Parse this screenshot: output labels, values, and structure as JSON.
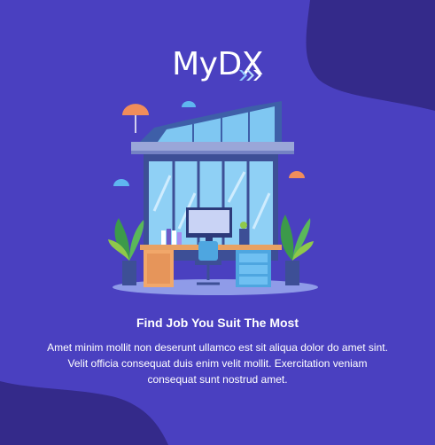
{
  "brand": {
    "name": "MyDX",
    "logo_icon": "triple-chevron-right-icon"
  },
  "onboarding": {
    "illustration": "office-workspace-illustration",
    "title": "Find Job You Suit The Most",
    "description": "Amet minim mollit non deserunt ullamco est sit aliqua dolor do amet sint. Velit officia consequat duis enim velit mollit. Exercitation veniam consequat sunt nostrud amet."
  },
  "colors": {
    "background": "#4a40c0",
    "blob": "#342a8a",
    "text": "#ffffff",
    "accent": "#8ec8ff"
  }
}
